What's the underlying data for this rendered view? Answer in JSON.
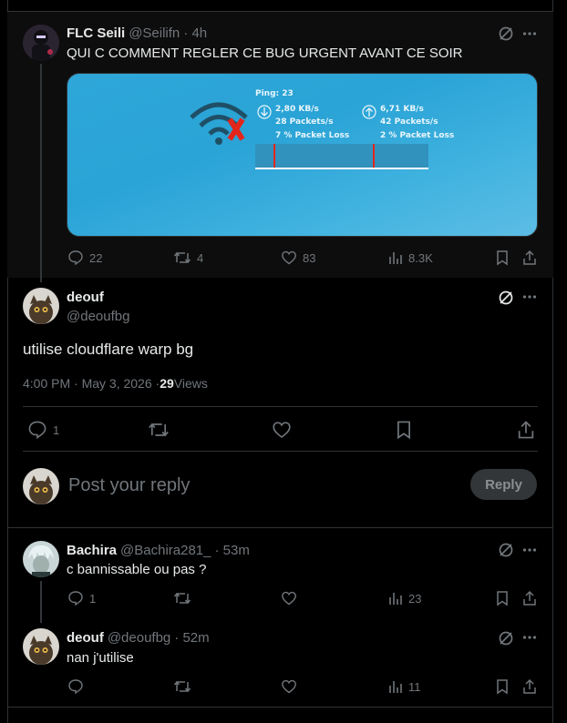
{
  "main_tweet": {
    "name": "FLC Seili",
    "handle": "@Seilifn",
    "time": "· 4h",
    "text": "QUI C COMMENT REGLER CE BUG URGENT AVANT CE SOIR",
    "media": {
      "ping": "Ping: 23",
      "down_speed": "2,80 KB/s",
      "down_packets": "28 Packets/s",
      "down_loss": "7 % Packet Loss",
      "up_speed": "6,71 KB/s",
      "up_packets": "42 Packets/s",
      "up_loss": "2 % Packet Loss"
    },
    "actions": {
      "replies": "22",
      "retweets": "4",
      "likes": "83",
      "views": "8.3K"
    }
  },
  "focused_tweet": {
    "name": "deouf",
    "handle": "@deoufbg",
    "text": "utilise cloudflare warp bg",
    "timestamp": "4:00 PM · May 3, 2026 · ",
    "views_count": "29",
    "views_label": " Views",
    "actions": {
      "replies": "1"
    }
  },
  "compose": {
    "placeholder": "Post your reply",
    "button_label": "Reply"
  },
  "replies": [
    {
      "name": "Bachira",
      "handle": "@Bachira281_",
      "time": "· 53m",
      "text": "c bannissable ou pas ?",
      "actions": {
        "replies": "1",
        "views": "23"
      }
    },
    {
      "name": "deouf",
      "handle": "@deoufbg",
      "time": "· 52m",
      "text": "nan j'utilise",
      "actions": {
        "views": "11"
      }
    }
  ],
  "colors": {
    "background": "#000000",
    "text": "#e7e9ea",
    "secondary_text": "#71767b",
    "border": "#2f3336",
    "media_blue": "#2ea6d8",
    "error_red": "#e2261c"
  }
}
